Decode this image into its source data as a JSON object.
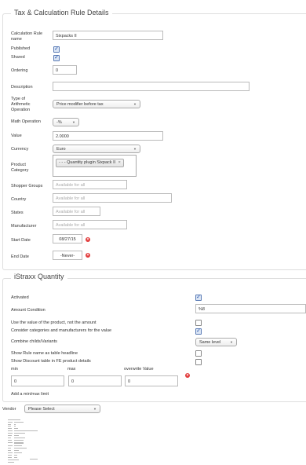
{
  "section1": {
    "title": "Tax & Calculation Rule Details",
    "fields": {
      "rule_name_label": "Calculation Rule name",
      "rule_name_value": "Sixpacks II",
      "published_label": "Published",
      "shared_label": "Shared",
      "ordering_label": "Ordering",
      "ordering_value": "0",
      "description_label": "Description",
      "type_label": "Type of Arithmetic Operation",
      "type_value": "Price modifier before tax",
      "math_label": "Math Operation",
      "math_value": "-%",
      "value_label": "Value",
      "value_value": "2.0000",
      "currency_label": "Currency",
      "currency_value": "Euro",
      "product_category_label": "Product Category",
      "product_category_tag": "- - - Quantity plugin Sixpack II",
      "shopper_groups_label": "Shopper Groups",
      "shopper_groups_placeholder": "Available for all",
      "country_label": "Country",
      "country_placeholder": "Available for all",
      "states_label": "States",
      "states_placeholder": "Available for all",
      "manufacturer_label": "Manufacturer",
      "manufacturer_placeholder": "Available for all",
      "start_date_label": "Start Date",
      "start_date_value": "08/27/15",
      "end_date_label": "End Date",
      "end_date_value": "-Never-"
    }
  },
  "section2": {
    "title": "iStraxx Quantity",
    "activated_label": "Activated",
    "amount_condition_label": "Amount Condition",
    "amount_condition_value": "%8",
    "use_value_label": "Use the value of the product, not the amount",
    "consider_label": "Consider categories and manufacturers for the value",
    "combine_label": "Combine childs/Variants",
    "combine_value": "Same level",
    "show_rule_label": "Show Rule name as table headline",
    "show_discount_label": "Show Discount table in FE product details",
    "col_min": "min",
    "col_max": "max",
    "col_overwrite": "overwrite Value",
    "min_value": "0",
    "max_value": "0",
    "overwrite_value": "0",
    "add_limit_label": "Add a min/max limit"
  },
  "vendor": {
    "label": "Vendor",
    "value": "Please Select"
  },
  "icons": {
    "checkmark": "✓",
    "remove": "×",
    "dropdown": "▼"
  }
}
